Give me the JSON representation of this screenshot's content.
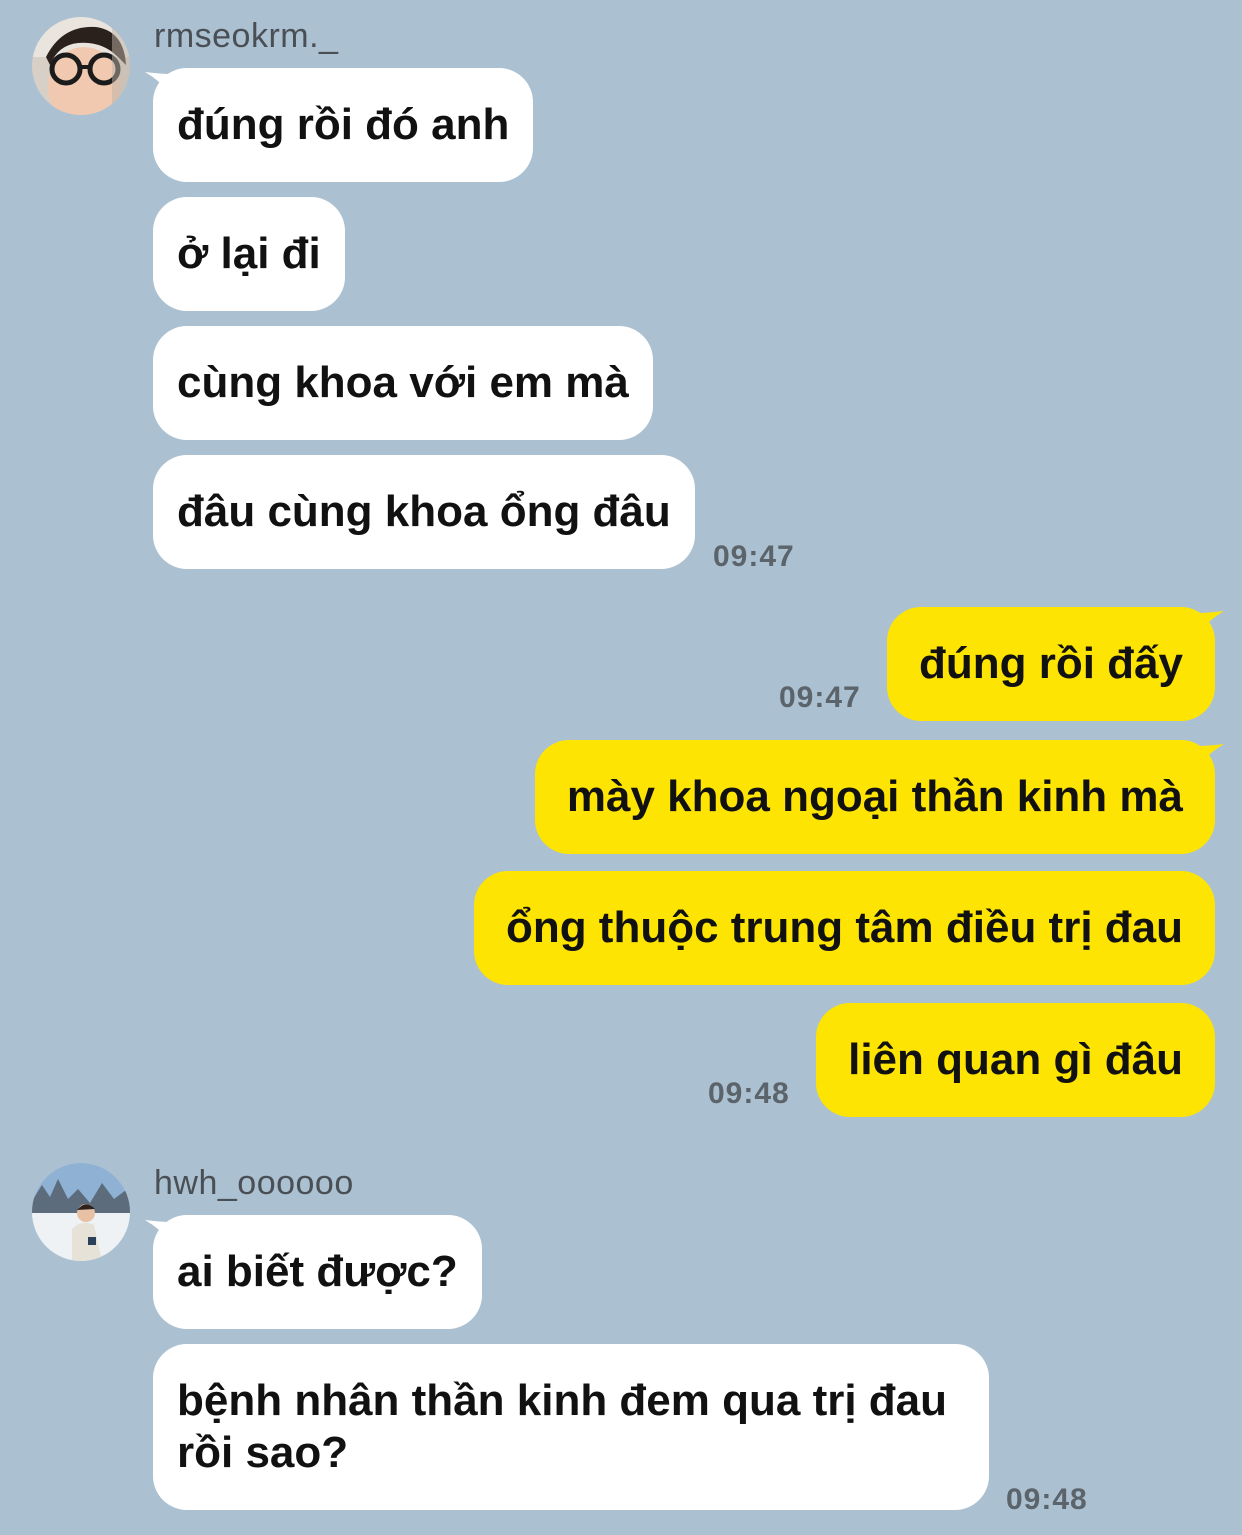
{
  "colors": {
    "background": "#abc1d1",
    "incoming_bubble": "#ffffff",
    "outgoing_bubble": "#fde402",
    "timestamp": "#5b636b"
  },
  "conversation": {
    "group1": {
      "sender": "rmseokrm._",
      "messages": [
        "đúng rồi đó anh",
        "ở lại đi",
        "cùng khoa với em mà",
        "đâu cùng khoa ổng đâu"
      ],
      "time": "09:47"
    },
    "group2": {
      "messages": [
        "đúng rồi đấy"
      ],
      "time": "09:47"
    },
    "group3": {
      "messages": [
        "mày khoa ngoại thần kinh mà",
        "ổng thuộc trung tâm điều trị đau",
        "liên quan gì đâu"
      ],
      "time": "09:48"
    },
    "group4": {
      "sender": "hwh_oooooo",
      "messages": [
        "ai biết được?",
        "bệnh nhân thần kinh đem qua trị đau rồi sao?"
      ],
      "time": "09:48"
    }
  }
}
